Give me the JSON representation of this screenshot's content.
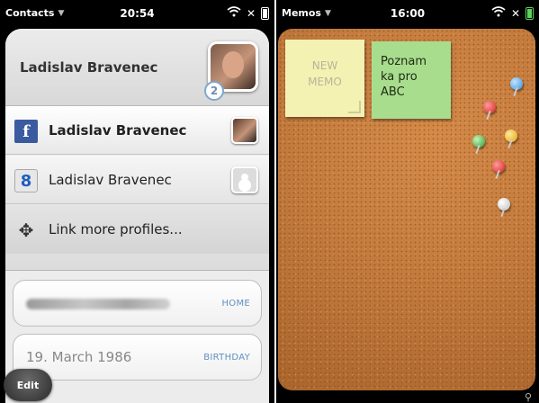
{
  "left_screen": {
    "statusbar": {
      "app_menu": "Contacts",
      "time": "20:54"
    },
    "contact": {
      "name": "Ladislav Bravenec",
      "profile_count": "2"
    },
    "profiles": [
      {
        "label": "Ladislav Bravenec",
        "service": "facebook",
        "icon": "facebook-icon"
      },
      {
        "label": "Ladislav Bravenec",
        "service": "google",
        "icon": "google-icon"
      },
      {
        "label": "Link more profiles...",
        "icon": "link-profiles-icon"
      }
    ],
    "fields": [
      {
        "value": "",
        "type": "HOME"
      },
      {
        "value": "19. March 1986",
        "type": "BIRTHDAY"
      }
    ],
    "edit_label": "Edit"
  },
  "right_screen": {
    "statusbar": {
      "app_menu": "Memos",
      "time": "16:00"
    },
    "memos": [
      {
        "text": "NEW MEMO",
        "color": "#f4f2b2"
      },
      {
        "text": "Poznam ka pro ABC",
        "color": "#a9dd8e"
      }
    ]
  }
}
